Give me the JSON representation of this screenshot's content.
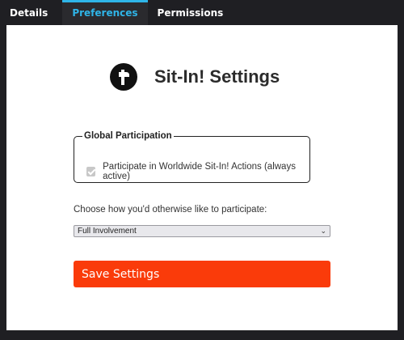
{
  "tabs": [
    {
      "label": "Details"
    },
    {
      "label": "Preferences"
    },
    {
      "label": "Permissions"
    }
  ],
  "active_tab": "Preferences",
  "header": {
    "title": "Sit-In! Settings",
    "logo_icon": "fist-logo-icon"
  },
  "global_participation": {
    "legend": "Global Participation",
    "checkbox_label": "Participate in Worldwide Sit-In! Actions (always active)",
    "checked": true,
    "disabled": true
  },
  "participation": {
    "prompt": "Choose how you'd otherwise like to participate:",
    "selected": "Full Involvement"
  },
  "save_button": {
    "label": "Save Settings"
  },
  "colors": {
    "accent_tab": "#2fb5e8",
    "save_button": "#fa3b0a",
    "background": "#1f1f23"
  }
}
